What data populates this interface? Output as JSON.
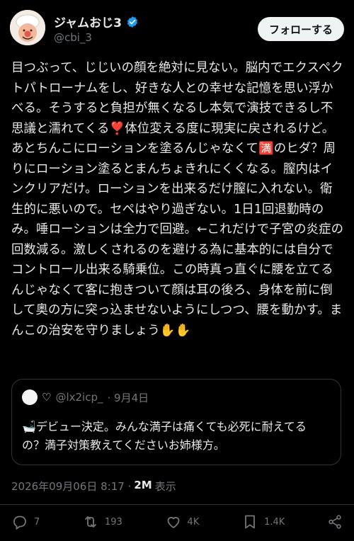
{
  "author": {
    "display_name": "ジャムおじ3",
    "handle": "@cbi_3",
    "verified": true
  },
  "follow_button": "フォローする",
  "post": {
    "text": "目つぶって、じじいの顔を絶対に見ない。脳内でエクスペクトパトローナムをし、好きな人との幸せな記憶を思い浮かべる。そうすると負担が無くなるし本気で演技できるし不思議と濡れてくる❣️体位変える度に現実に戻されるけど。あとちんこにローションを塗るんじゃなくて🈵のヒダ？周りにローション塗るとまんちょきれにくくなる。膣内はインクリアだけ。ローションを出来るだけ膣に入れない。衛生的に悪いので。セペはやり過ぎない。1日1回退勤時のみ。唾ローションは全力で回避。←これだけで子宮の炎症の回数減る。激しくされるのを避ける為に基本的には自分でコントロール出来る騎乗位。この時真っ直ぐに腰を立てるんじゃなくて客に抱きついて顔は耳の後ろ、身体を前に倒して奥の方に突っ込ませないようにしつつ、腰を動かす。まんこの治安を守りましょう✋✋"
  },
  "quote": {
    "heart": "♡",
    "handle": "@lx2icp_",
    "date": "· 9月4日",
    "text": "🛁デビュー決定。みんな満子は痛くても必死に耐えてるの？満子対策教えてくださいお姉様方。"
  },
  "meta": {
    "timestamp": "2026年09月06日 8:17 ·",
    "views": "2M",
    "views_label": "表示"
  },
  "actions": {
    "replies": "7",
    "reposts": "193",
    "likes": "4K",
    "bookmarks": "1.4K"
  },
  "colors": {
    "background": "#000000",
    "text": "#e7e9ea",
    "muted": "#71767b",
    "verified": "#1d9bf0",
    "border": "#2f3336"
  }
}
